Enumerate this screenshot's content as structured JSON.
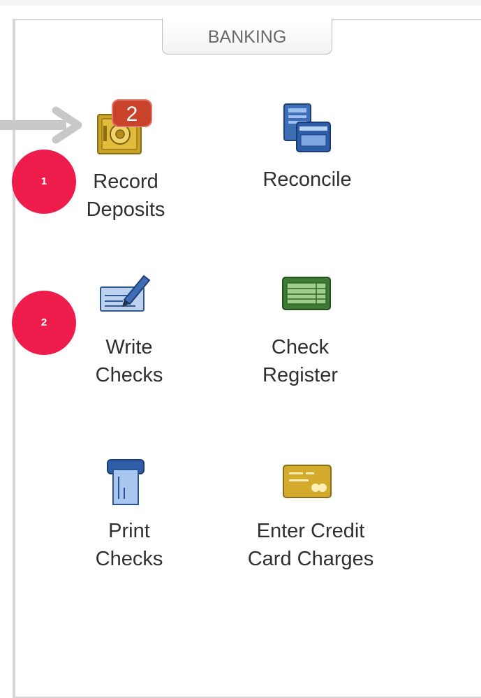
{
  "section": {
    "title": "BANKING"
  },
  "markers": [
    "1",
    "2"
  ],
  "items": [
    {
      "line1": "Record",
      "line2": "Deposits",
      "icon": "safe-icon",
      "badge": "2"
    },
    {
      "line1": "Reconcile",
      "line2": "",
      "icon": "reconcile-icon"
    },
    {
      "line1": "Write",
      "line2": "Checks",
      "icon": "write-checks-icon"
    },
    {
      "line1": "Check",
      "line2": "Register",
      "icon": "check-register-icon"
    },
    {
      "line1": "Print",
      "line2": "Checks",
      "icon": "printer-icon"
    },
    {
      "line1": "Enter Credit",
      "line2": "Card Charges",
      "icon": "credit-card-icon"
    }
  ],
  "colors": {
    "marker": "#ee1c4a",
    "badge": "#c9432a",
    "arrow": "#c8c8c8"
  }
}
